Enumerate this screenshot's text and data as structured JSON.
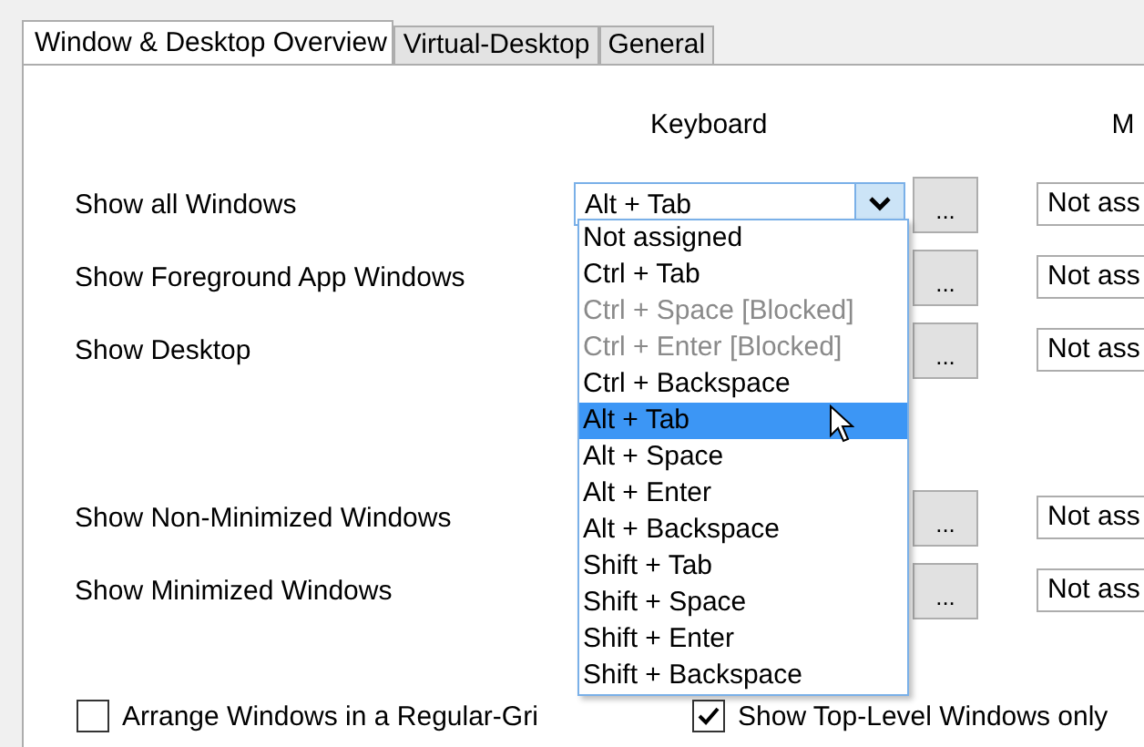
{
  "tabs": [
    {
      "label": "Window & Desktop Overview",
      "selected": true
    },
    {
      "label": "Virtual-Desktop",
      "selected": false
    },
    {
      "label": "General",
      "selected": false
    }
  ],
  "columns": {
    "keyboard": "Keyboard",
    "column_2": "M"
  },
  "shortcut_groups": [
    {
      "rows": [
        {
          "label": "Show all Windows",
          "keyboard": "Alt + Tab",
          "button": "...",
          "mouse": "Not ass"
        },
        {
          "label": "Show Foreground App Windows",
          "button": "...",
          "mouse": "Not ass"
        },
        {
          "label": "Show Desktop",
          "button": "...",
          "mouse": "Not ass"
        }
      ]
    },
    {
      "rows": [
        {
          "label": "Show Non-Minimized Windows",
          "button": "...",
          "mouse": "Not ass"
        },
        {
          "label": "Show Minimized Windows",
          "button": "...",
          "mouse": "Not ass"
        }
      ]
    }
  ],
  "options": [
    {
      "label": "Arrange Windows in a Regular-Gri",
      "checked": false
    },
    {
      "label": "Show Top-Level Windows only",
      "checked": true
    }
  ],
  "dropdown": {
    "items": [
      {
        "label": "Not assigned",
        "selected": false,
        "disabled": false
      },
      {
        "label": "Ctrl + Tab",
        "selected": false,
        "disabled": false
      },
      {
        "label": "Ctrl + Space [Blocked]",
        "selected": false,
        "disabled": true
      },
      {
        "label": "Ctrl + Enter [Blocked]",
        "selected": false,
        "disabled": true
      },
      {
        "label": "Ctrl + Backspace",
        "selected": false,
        "disabled": false
      },
      {
        "label": "Alt + Tab",
        "selected": true,
        "disabled": false
      },
      {
        "label": "Alt + Space",
        "selected": false,
        "disabled": false
      },
      {
        "label": "Alt + Enter",
        "selected": false,
        "disabled": false
      },
      {
        "label": "Alt + Backspace",
        "selected": false,
        "disabled": false
      },
      {
        "label": "Shift + Tab",
        "selected": false,
        "disabled": false
      },
      {
        "label": "Shift + Space",
        "selected": false,
        "disabled": false
      },
      {
        "label": "Shift + Enter",
        "selected": false,
        "disabled": false
      },
      {
        "label": "Shift + Backspace",
        "selected": false,
        "disabled": false
      }
    ]
  }
}
